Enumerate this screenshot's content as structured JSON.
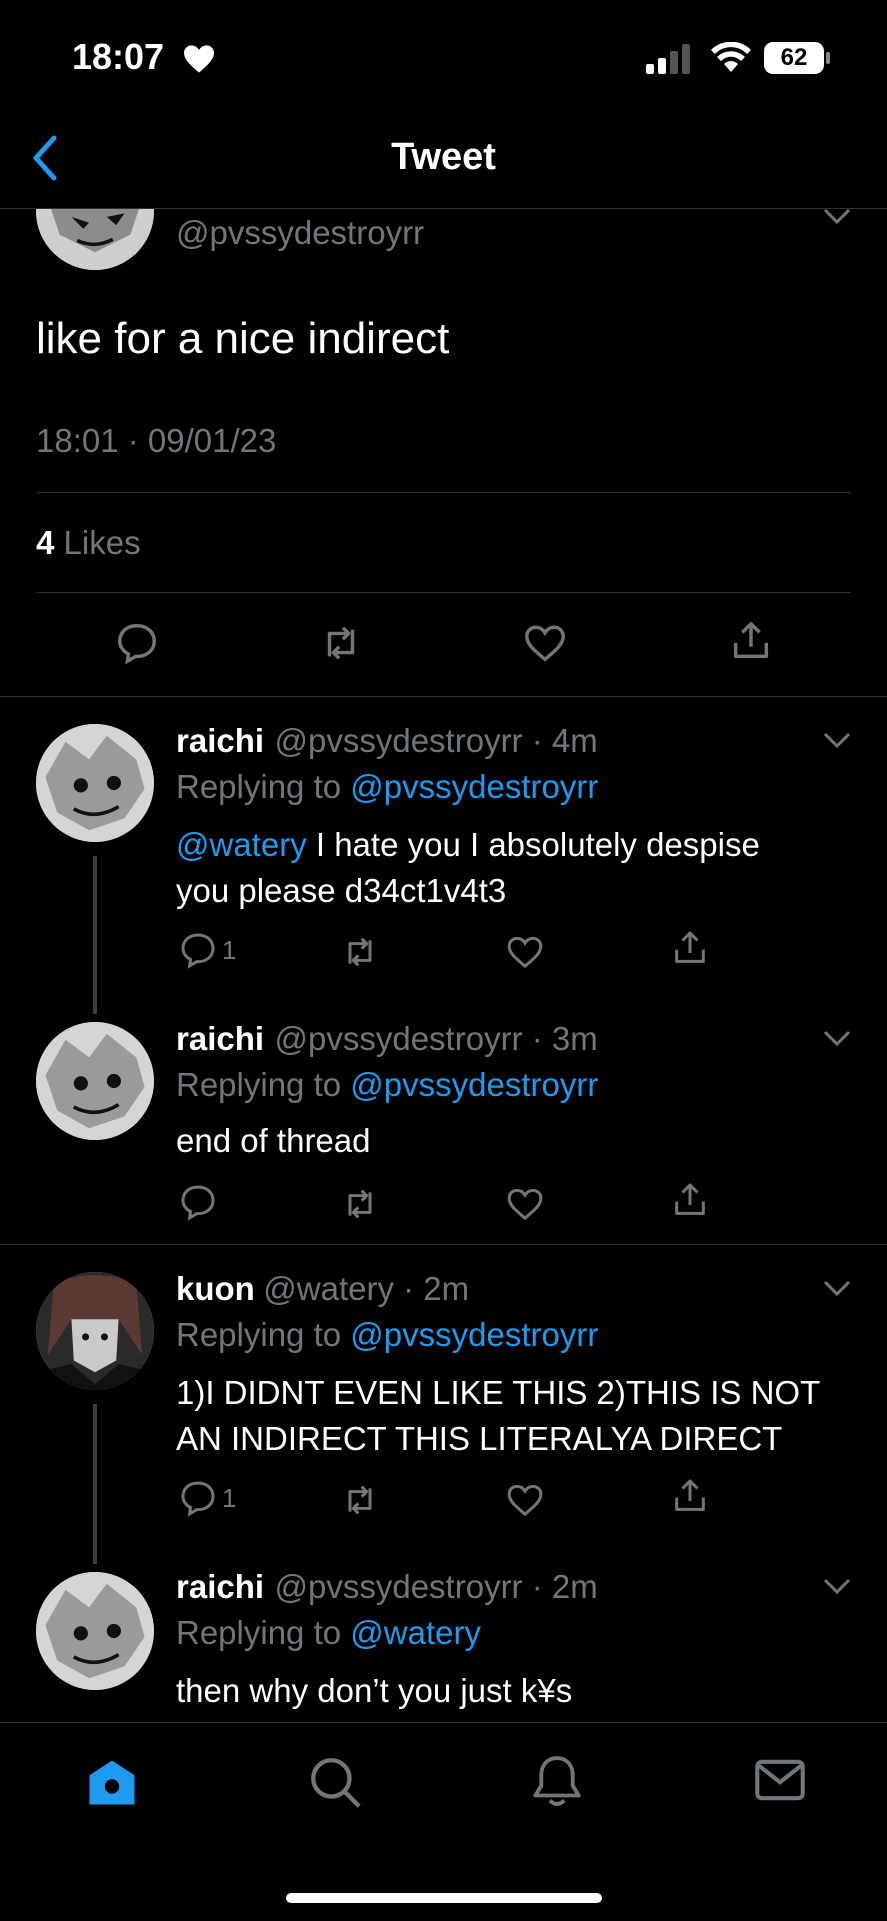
{
  "status_bar": {
    "time": "18:07",
    "battery": "62"
  },
  "header": {
    "title": "Tweet"
  },
  "main_tweet": {
    "handle": "@pvssydestroyrr",
    "text": "like for a nice indirect",
    "timestamp": "18:01 · 09/01/23",
    "likes_count": "4",
    "likes_label": "Likes"
  },
  "replies": [
    {
      "name": "raichi",
      "meta": "@pvssydestroyrr · 4m",
      "replying_prefix": "Replying to",
      "replying_to": "@pvssydestroyrr",
      "mention": "@watery",
      "text_line1_rest": " I hate you I absolutely despise",
      "text_line2": "you please d34ct1v4t3",
      "reply_count": "1"
    },
    {
      "name": "raichi",
      "meta": "@pvssydestroyrr · 3m",
      "replying_prefix": "Replying to",
      "replying_to": "@pvssydestroyrr",
      "text": "end of thread"
    },
    {
      "name": "kuon",
      "meta": "@watery · 2m",
      "replying_prefix": "Replying to",
      "replying_to": "@pvssydestroyrr",
      "text_line1": "1)I DIDNT EVEN LIKE THIS 2)THIS IS NOT",
      "text_line2": "AN INDIRECT THIS LITERALYA DIRECT",
      "reply_count": "1"
    },
    {
      "name": "raichi",
      "meta": "@pvssydestroyrr · 2m",
      "replying_prefix": "Replying to",
      "replying_to": "@watery",
      "text": "then why don’t you just k¥s"
    }
  ],
  "icons": {
    "back": "chevron-left-icon",
    "reply": "speech-bubble-icon",
    "retweet": "retweet-icon",
    "like": "heart-icon",
    "share": "share-icon",
    "home": "home-icon",
    "search": "search-icon",
    "notifications": "bell-icon",
    "messages": "envelope-icon"
  },
  "colors": {
    "accent": "#1d9bf0",
    "muted": "#71767b",
    "background": "#000000",
    "divider": "#2f3336"
  }
}
